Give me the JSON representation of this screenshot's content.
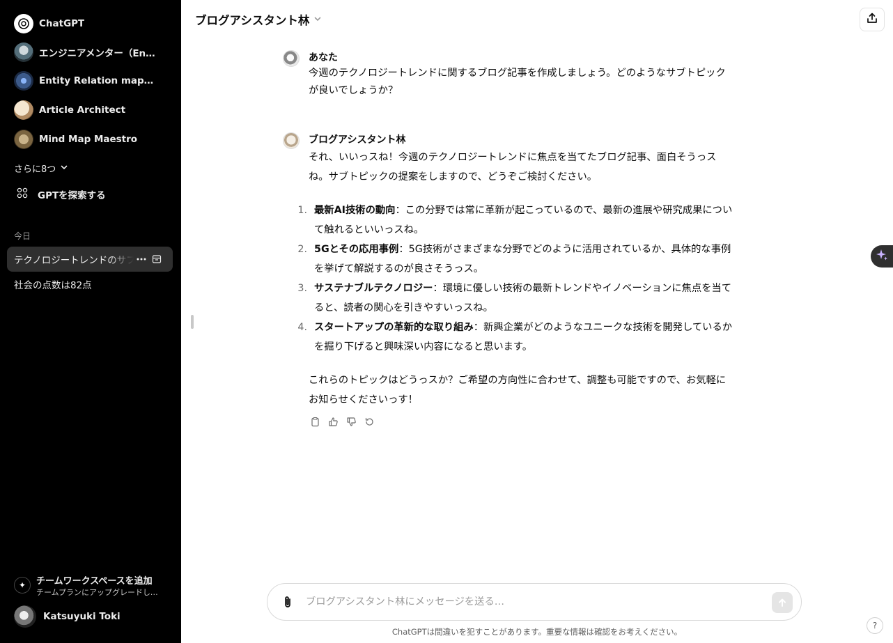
{
  "sidebar": {
    "gpts": [
      {
        "label": "ChatGPT",
        "icon": "openai-logo-icon"
      },
      {
        "label": "エンジニアメンター（Engin…",
        "icon": "engineer-mentor-avatar"
      },
      {
        "label": "Entity Relation mapping",
        "icon": "entity-relation-avatar"
      },
      {
        "label": "Article Architect",
        "icon": "article-architect-avatar"
      },
      {
        "label": "Mind Map Maestro",
        "icon": "mind-map-avatar"
      }
    ],
    "more_label": "さらに8つ",
    "explore_label": "GPTを探索する",
    "section_today": "今日",
    "chats": [
      {
        "label": "テクノロジートレンドのサブトピック",
        "active": true
      },
      {
        "label": "社会の点数は82点",
        "active": false
      }
    ],
    "upgrade": {
      "title": "チームワークスペースを追加",
      "subtitle": "チームプランにアップグレードして共同作業…"
    },
    "user_name": "Katsuyuki Toki"
  },
  "header": {
    "title": "ブログアシスタント林"
  },
  "conversation": {
    "user": {
      "author": "あなた",
      "text": "今週のテクノロジートレンドに関するブログ記事を作成しましょう。どのようなサブトピックが良いでしょうか？"
    },
    "assistant": {
      "author": "ブログアシスタント林",
      "intro": "それ、いいっスね！今週のテクノロジートレンドに焦点を当てたブログ記事、面白そうっスね。サブトピックの提案をしますので、どうぞご検討ください。",
      "topics": [
        {
          "num": "1.",
          "title": "最新AI技術の動向",
          "desc": "：この分野では常に革新が起こっているので、最新の進展や研究成果について触れるといいっスね。"
        },
        {
          "num": "2.",
          "title": "5Gとその応用事例",
          "desc": "：5G技術がさまざまな分野でどのように活用されているか、具体的な事例を挙げて解説するのが良さそうっス。"
        },
        {
          "num": "3.",
          "title": "サステナブルテクノロジー",
          "desc": "：環境に優しい技術の最新トレンドやイノベーションに焦点を当てると、読者の関心を引きやすいっスね。"
        },
        {
          "num": "4.",
          "title": "スタートアップの革新的な取り組み",
          "desc": "：新興企業がどのようなユニークな技術を開発しているかを掘り下げると興味深い内容になると思います。"
        }
      ],
      "closing": "これらのトピックはどうっスか？ご希望の方向性に合わせて、調整も可能ですので、お気軽にお知らせくださいっす！"
    }
  },
  "composer": {
    "placeholder": "ブログアシスタント林にメッセージを送る…"
  },
  "footer": {
    "disclaimer": "ChatGPTは間違いを犯すことがあります。重要な情報は確認をお考えください。",
    "help": "?"
  }
}
